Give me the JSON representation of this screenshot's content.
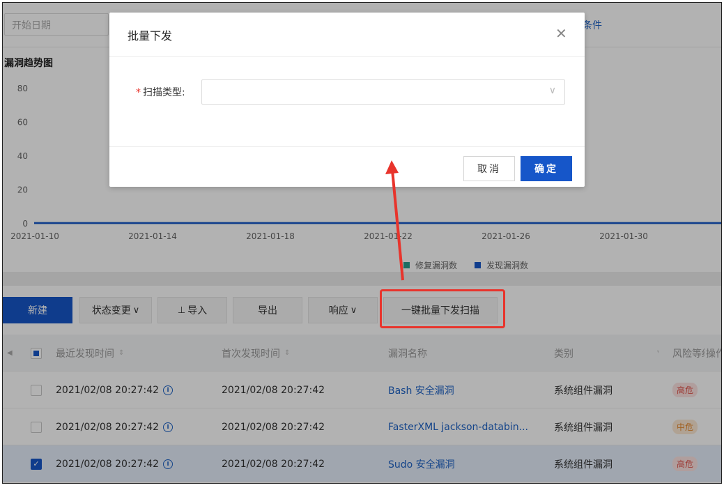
{
  "filter": {
    "start_date_placeholder": "开始日期",
    "condition_link": "条件"
  },
  "chart_data": {
    "type": "line",
    "title": "漏洞趋势图",
    "x": [
      "2021-01-10",
      "2021-01-14",
      "2021-01-18",
      "2021-01-22",
      "2021-01-26",
      "2021-01-30"
    ],
    "y_ticks": [
      0,
      20,
      40,
      60,
      80
    ],
    "ylim": [
      0,
      80
    ],
    "series": [
      {
        "name": "修复漏洞数",
        "color": "#2a9d8f",
        "values": [
          0,
          0,
          0,
          0,
          0,
          0
        ]
      },
      {
        "name": "发现漏洞数",
        "color": "#1656c9",
        "values": [
          0,
          0,
          0,
          0,
          0,
          0
        ]
      }
    ],
    "legend": "bottom-center",
    "grid": false
  },
  "toolbar": {
    "new_label": "新建",
    "status_label": "状态变更",
    "import_label": "导入",
    "export_label": "导出",
    "respond_label": "响应",
    "batch_scan_label": "一键批量下发扫描"
  },
  "table": {
    "headers": {
      "recent": "最近发现时间",
      "first": "首次发现时间",
      "name": "漏洞名称",
      "category": "类别",
      "risk": "风险等级",
      "op": "操作"
    },
    "rows": [
      {
        "recent": "2021/02/08 20:27:42",
        "first": "2021/02/08 20:27:42",
        "name": "Bash 安全漏洞",
        "category": "系统组件漏洞",
        "risk": "高危",
        "risk_level": "high",
        "checked": false
      },
      {
        "recent": "2021/02/08 20:27:42",
        "first": "2021/02/08 20:27:42",
        "name": "FasterXML jackson-databin...",
        "category": "系统组件漏洞",
        "risk": "中危",
        "risk_level": "mid",
        "checked": false
      },
      {
        "recent": "2021/02/08 20:27:42",
        "first": "2021/02/08 20:27:42",
        "name": "Sudo 安全漏洞",
        "category": "系统组件漏洞",
        "risk": "高危",
        "risk_level": "high",
        "checked": true
      }
    ]
  },
  "modal": {
    "title": "批量下发",
    "field_label": "扫描类型:",
    "field_value": "",
    "cancel_label": "取消",
    "ok_label": "确定"
  },
  "colors": {
    "primary": "#1656c9",
    "annotation_red": "#e8342c"
  }
}
